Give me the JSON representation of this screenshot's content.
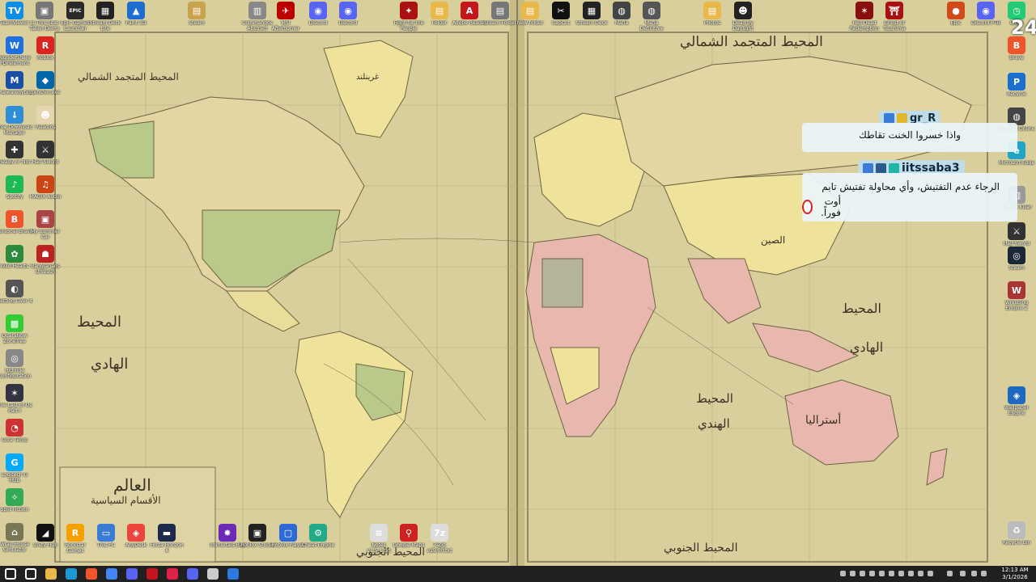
{
  "desktop_top_icons": [
    {
      "label": "TeamViewer",
      "color": "#0e8ee9",
      "glyph": "TV"
    },
    {
      "label": "Is This Seat Taken Demo",
      "color": "#777",
      "glyph": "▣"
    },
    {
      "label": "Epic Games Launcher",
      "color": "#2a2a2a",
      "glyph": "EPIC"
    },
    {
      "label": "Stream Deck Lite",
      "color": "#222",
      "glyph": "▦"
    },
    {
      "label": "Paint 3D",
      "color": "#1c6fd1",
      "glyph": "▲"
    },
    {
      "label": "Steam",
      "color": "#caa34d",
      "glyph": "▤"
    },
    {
      "label": "Commandos Abstract",
      "color": "#888",
      "glyph": "▥"
    },
    {
      "label": "MSI Afterburner",
      "color": "#b00",
      "glyph": "✈"
    },
    {
      "label": "Discord",
      "color": "#5865f2",
      "glyph": "◉"
    },
    {
      "label": "Discord",
      "color": "#5865f2",
      "glyph": "◉"
    },
    {
      "label": "Fight for the People",
      "color": "#a11",
      "glyph": "✦"
    },
    {
      "label": "Folder",
      "color": "#e8b94a",
      "glyph": "▤"
    },
    {
      "label": "Adobe Reader",
      "color": "#c4161c",
      "glyph": "A"
    },
    {
      "label": "Steam Folder",
      "color": "#777",
      "glyph": "▤"
    },
    {
      "label": "New folder",
      "color": "#e8b94a",
      "glyph": "▤"
    },
    {
      "label": "CapCut",
      "color": "#111",
      "glyph": "✂"
    },
    {
      "label": "Stream Deck",
      "color": "#222",
      "glyph": "▦"
    },
    {
      "label": "Mafia",
      "color": "#444",
      "glyph": "◍"
    },
    {
      "label": "Mafia Definitive",
      "color": "#555",
      "glyph": "◍"
    },
    {
      "label": "Photos",
      "color": "#e8b94a",
      "glyph": "▤"
    },
    {
      "label": "Dead by Daylight",
      "color": "#222",
      "glyph": "☻"
    },
    {
      "label": "Red Dead Redemption",
      "color": "#8a1010",
      "glyph": "✶"
    },
    {
      "label": "Ghost of Tsushima",
      "color": "#a11",
      "glyph": "⛩"
    },
    {
      "label": "Epic",
      "color": "#d04a1a",
      "glyph": "●"
    },
    {
      "label": "Discord PTB",
      "color": "#5865f2",
      "glyph": "◉"
    },
    {
      "label": "Clock",
      "color": "#2c7",
      "glyph": "◷"
    }
  ],
  "desktop_left_icons": [
    {
      "label": "Wondershare PDFelement",
      "color": "#1e6fe0",
      "glyph": "W"
    },
    {
      "label": "Malwarebytes",
      "color": "#1a4fa8",
      "glyph": "M"
    },
    {
      "label": "Free Download Manager",
      "color": "#2f8ed8",
      "glyph": "↓"
    },
    {
      "label": "Ready or Not",
      "color": "#333",
      "glyph": "✚"
    },
    {
      "label": "Spotify",
      "color": "#1db954",
      "glyph": "♪"
    },
    {
      "label": "Personal Brave",
      "color": "#f0542b",
      "glyph": "B"
    },
    {
      "label": "Wild Hearts",
      "color": "#2d8a3c",
      "glyph": "✿"
    },
    {
      "label": "Getting Over It",
      "color": "#555",
      "glyph": "◐"
    },
    {
      "label": "QuaraNow ZoneTree",
      "color": "#3c3",
      "glyph": "▩"
    },
    {
      "label": "HidHide Configuration",
      "color": "#888",
      "glyph": "◎"
    },
    {
      "label": "The Last of Us Part I",
      "color": "#334",
      "glyph": "✶"
    },
    {
      "label": "Core Temp",
      "color": "#c33",
      "glyph": "◔"
    },
    {
      "label": "Logitech G HUB",
      "color": "#0af",
      "glyph": "G"
    },
    {
      "label": "Split Fiction",
      "color": "#3a5",
      "glyph": "✧"
    },
    {
      "label": "Wrap House Simulator",
      "color": "#775",
      "glyph": "⌂"
    }
  ],
  "desktop_left_icons2": [
    {
      "label": "Roblox",
      "color": "#d22",
      "glyph": "R"
    },
    {
      "label": "genshin.exe",
      "color": "#06a",
      "glyph": "◆"
    },
    {
      "label": "Paladins",
      "color": "#e6d6b0",
      "glyph": "☻"
    },
    {
      "label": "Half Sword",
      "color": "#333",
      "glyph": "⚔"
    },
    {
      "label": "MAGIX Audio",
      "color": "#c41",
      "glyph": "♫"
    },
    {
      "label": "My Summer Car",
      "color": "#a44",
      "glyph": "▣"
    },
    {
      "label": "Banglarians Unleash",
      "color": "#b22",
      "glyph": "☗"
    }
  ],
  "desktop_bottom_icons": [
    {
      "label": "Unity Hub",
      "color": "#111",
      "glyph": "◢"
    },
    {
      "label": "Rockstar Games Launcher",
      "color": "#f4a100",
      "glyph": "R"
    },
    {
      "label": "This PC",
      "color": "#3a7bd5",
      "glyph": "▭"
    },
    {
      "label": "AnyDesk",
      "color": "#ef443b",
      "glyph": "◈"
    },
    {
      "label": "Forza Horizon 4",
      "color": "#1b2a4d",
      "glyph": "▬"
    },
    {
      "label": "Immortals Bay",
      "color": "#6b2bb5",
      "glyph": "✸"
    },
    {
      "label": "Roblox Studio",
      "color": "#222",
      "glyph": "▣"
    },
    {
      "label": "Roblox Player",
      "color": "#2d6ad5",
      "glyph": "▢"
    },
    {
      "label": "Cheat Engine",
      "color": "#2a8",
      "glyph": "⚙"
    },
    {
      "label": "Notes v1.5.1.txt",
      "color": "#ddd",
      "glyph": "≡"
    },
    {
      "label": "Google Maps",
      "color": "#c22",
      "glyph": "⚲"
    },
    {
      "label": "7-Zip v19.00.txt",
      "color": "#ddd",
      "glyph": "7z"
    }
  ],
  "desktop_right_icons": [
    {
      "label": "Brave",
      "color": "#f0542b",
      "glyph": "B"
    },
    {
      "label": "Recycle",
      "color": "#1a6fd1",
      "glyph": "P"
    },
    {
      "label": "Mafia III Online",
      "color": "#444",
      "glyph": "◍"
    },
    {
      "label": "Microsoft Edge",
      "color": "#1fa5c8",
      "glyph": "e"
    },
    {
      "label": "Screen Killer",
      "color": "#999",
      "glyph": "▥"
    },
    {
      "label": "Half Sword Demo",
      "color": "#333",
      "glyph": "⚔"
    },
    {
      "label": "Steam",
      "color": "#1b2838",
      "glyph": "◎"
    },
    {
      "label": "Wrestling Empire 2",
      "color": "#a33",
      "glyph": "W"
    },
    {
      "label": "Wallpaper Engine",
      "color": "#1d69c2",
      "glyph": "◈"
    },
    {
      "label": "Recycle Bin",
      "color": "#bbb",
      "glyph": "♻"
    }
  ],
  "map": {
    "labels": [
      {
        "text": "المحيط المتجمد الشمالي",
        "size": 17
      },
      {
        "text": "المحيط المتجمد الشمالي",
        "size": 12
      },
      {
        "text": "المحيط",
        "size": 18
      },
      {
        "text": "الهادي",
        "size": 18
      },
      {
        "text": "المحيط",
        "size": 16
      },
      {
        "text": "الهادي",
        "size": 16
      },
      {
        "text": "المحيط",
        "size": 15
      },
      {
        "text": "الهندي",
        "size": 15
      },
      {
        "text": "المحيط الجنوبي",
        "size": 14
      },
      {
        "text": "المحيط الجنوبي",
        "size": 13
      },
      {
        "text": "العالم",
        "size": 20
      },
      {
        "text": "الأقسام السياسية",
        "size": 12
      },
      {
        "text": "غرينلند",
        "size": 10
      },
      {
        "text": "الصين",
        "size": 12
      },
      {
        "text": "أستراليا",
        "size": 14
      }
    ]
  },
  "chat": {
    "messages": [
      {
        "username": "gr_R",
        "username_color": "#0a2a45",
        "text": "واذا خسروا الخنت تقاطك"
      },
      {
        "username": "iitssaba3",
        "username_color": "#0a2a45",
        "text": "الرجاء عدم التفتيش، وأي محاولة تفتيش تابم",
        "text2": "أوت فوراً."
      }
    ],
    "overlay_clock": "24"
  },
  "taskbar": {
    "time": "12:13 AM",
    "date": "3/1/2026",
    "apps": [
      {
        "name": "start",
        "color": "#fff"
      },
      {
        "name": "search",
        "color": "#fff"
      },
      {
        "name": "file-explorer",
        "color": "#e8b94a"
      },
      {
        "name": "steam",
        "color": "#1b9ad6"
      },
      {
        "name": "brave",
        "color": "#f0542b"
      },
      {
        "name": "chrome",
        "color": "#4285f4"
      },
      {
        "name": "discord",
        "color": "#5865f2"
      },
      {
        "name": "adobe",
        "color": "#c4161c"
      },
      {
        "name": "opera",
        "color": "#e0214a"
      },
      {
        "name": "discord",
        "color": "#5865f2"
      },
      {
        "name": "settings",
        "color": "#ccc"
      },
      {
        "name": "photos",
        "color": "#2a7be0"
      }
    ]
  }
}
